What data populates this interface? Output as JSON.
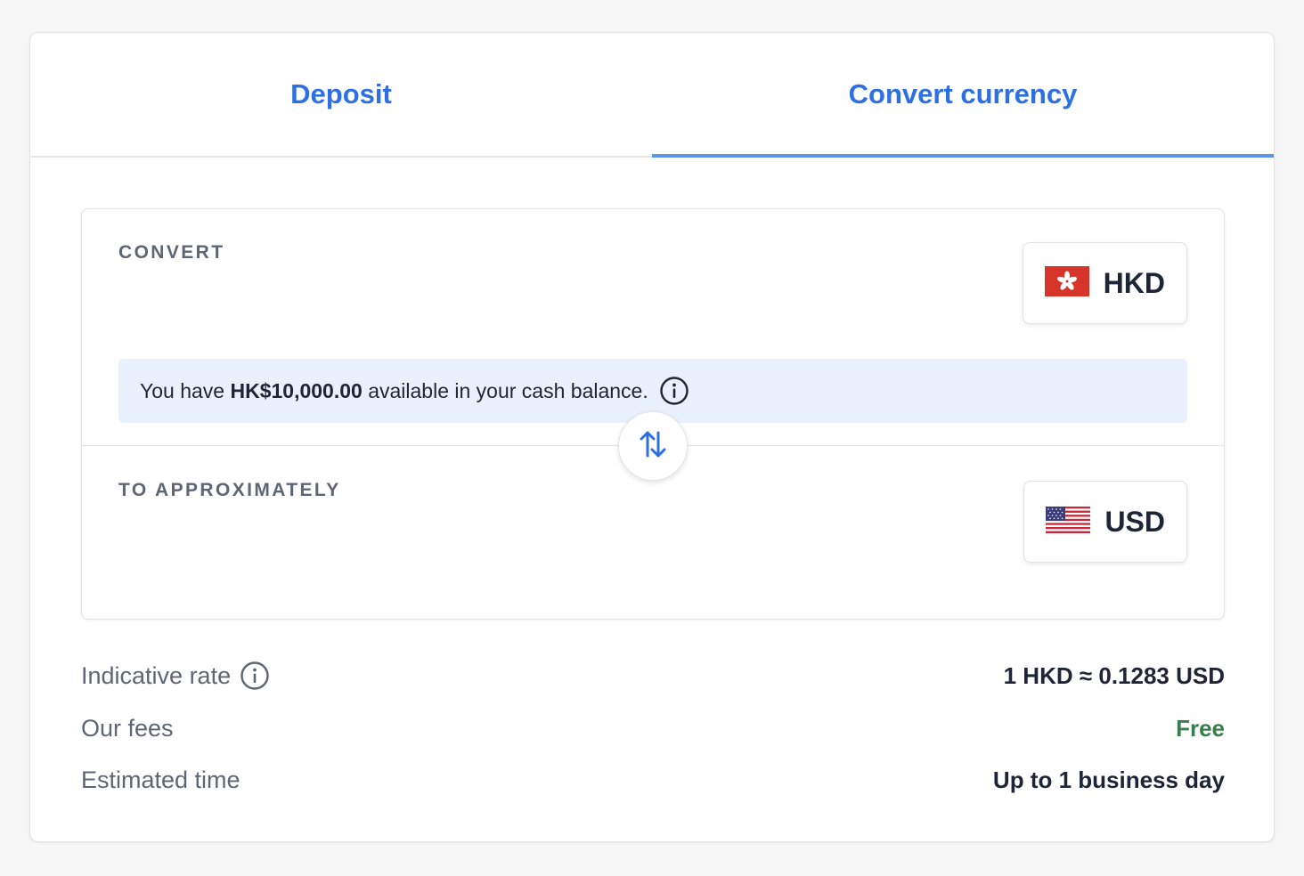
{
  "tabs": [
    {
      "label": "Deposit",
      "active": false
    },
    {
      "label": "Convert currency",
      "active": true
    }
  ],
  "convert": {
    "from_label": "CONVERT",
    "from_currency": "HKD",
    "from_flag": "hong-kong-flag-icon",
    "balance_prefix": "You have ",
    "balance_amount": "HK$10,000.00",
    "balance_suffix": " available in your cash balance.",
    "to_label": "TO APPROXIMATELY",
    "to_currency": "USD",
    "to_flag": "us-flag-icon"
  },
  "details": {
    "rate_label": "Indicative rate",
    "rate_value": "1 HKD ≈ 0.1283 USD",
    "fees_label": "Our fees",
    "fees_value": "Free",
    "time_label": "Estimated time",
    "time_value": "Up to 1 business day"
  },
  "colors": {
    "accent": "#2f6fe4",
    "free": "#3a7d4f",
    "note_bg": "#e9f1fc"
  }
}
